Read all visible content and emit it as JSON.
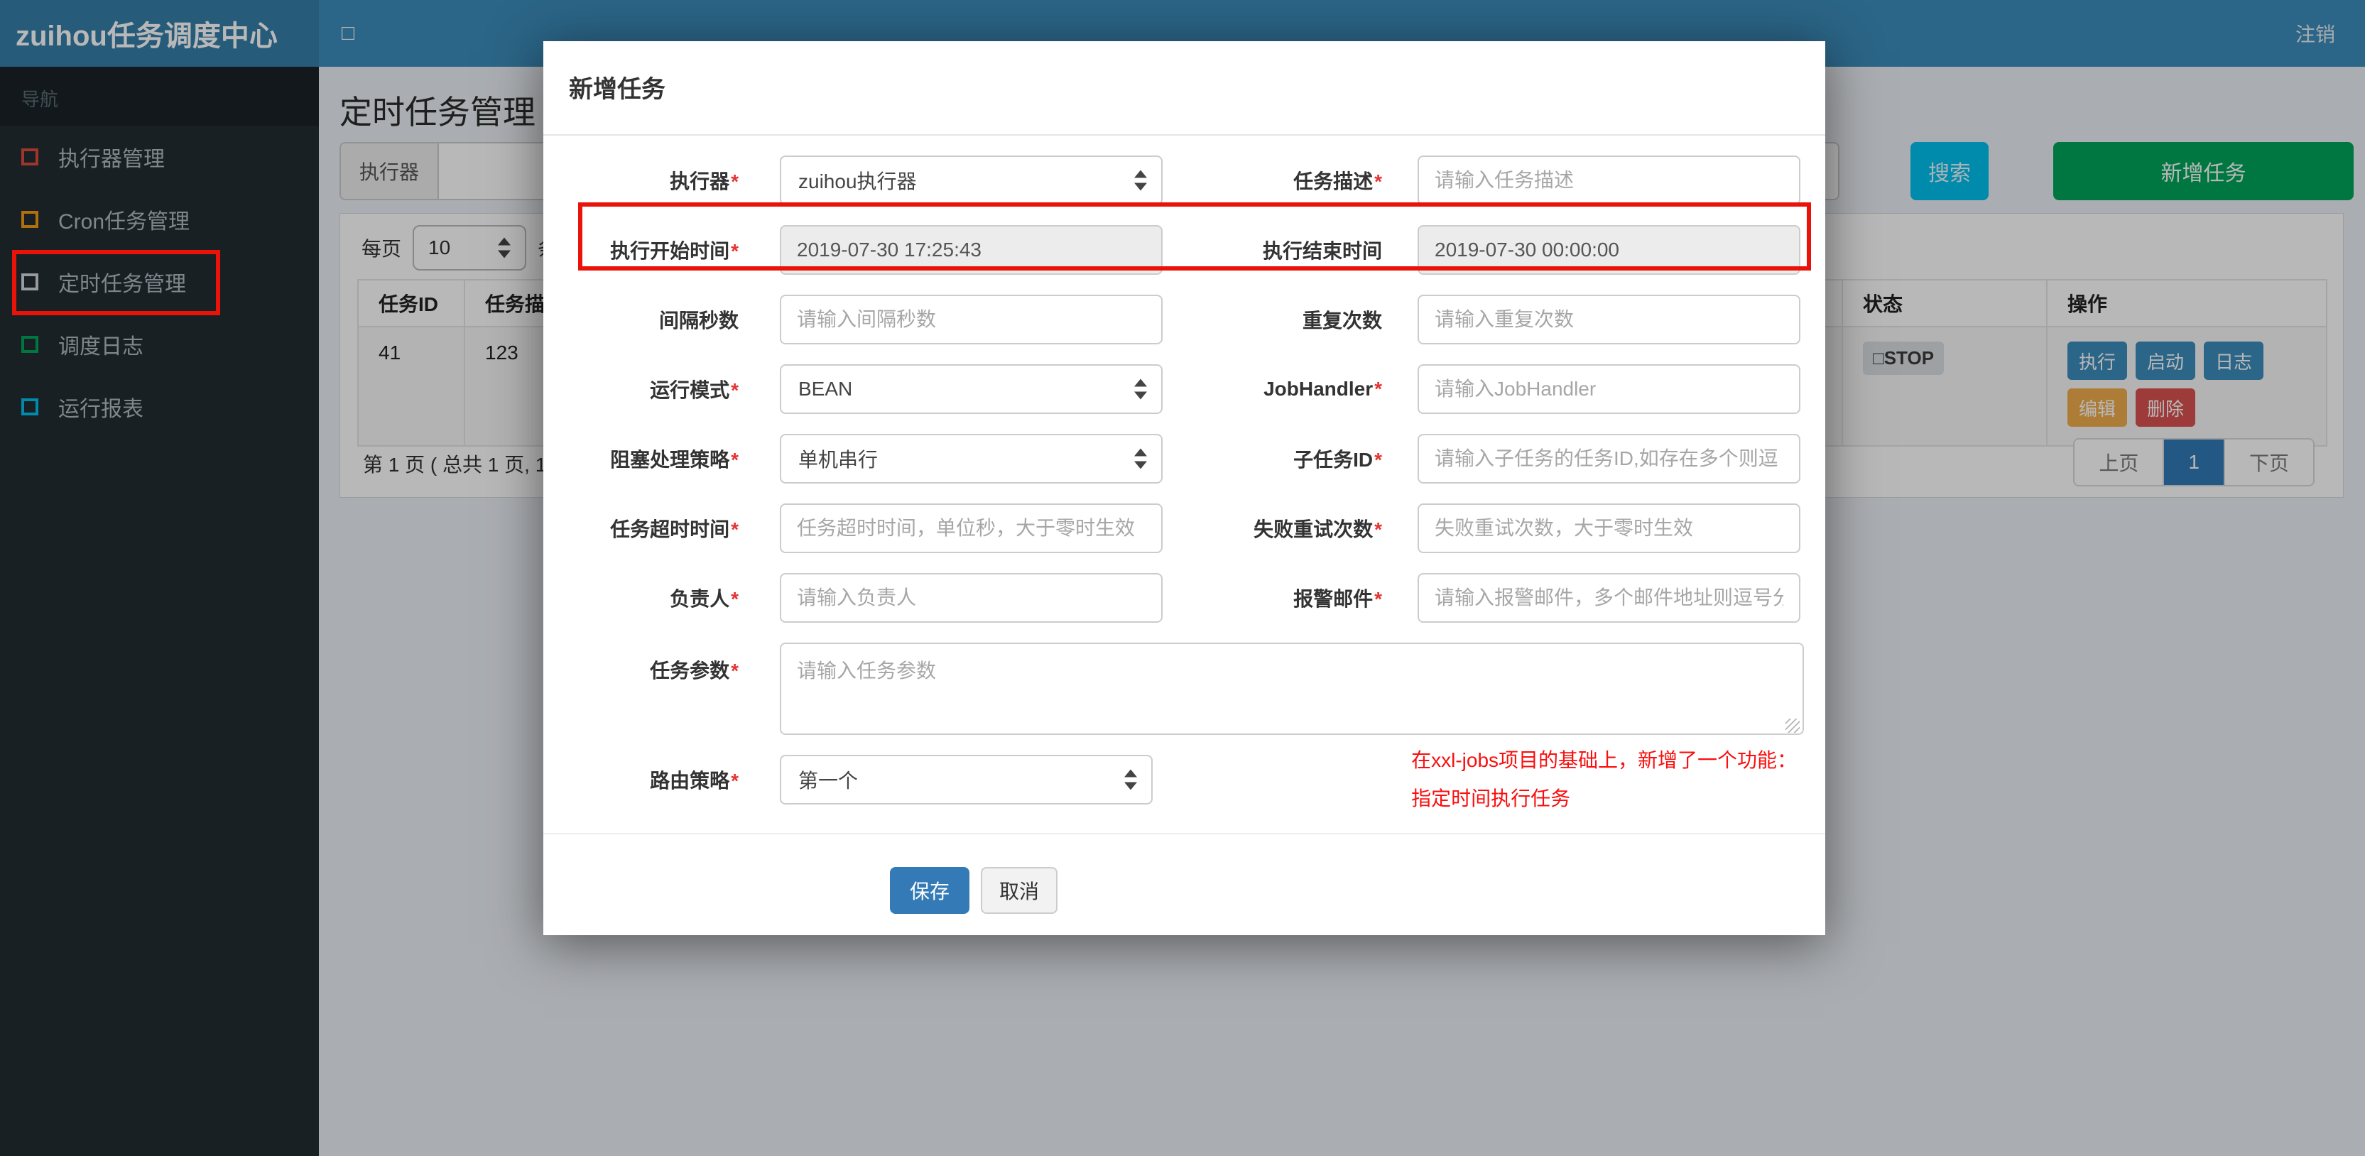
{
  "header": {
    "brand": "zuihou任务调度中心",
    "toggle_glyph": "□",
    "logout": "注销"
  },
  "sidebar": {
    "section_label": "导航",
    "items": [
      {
        "label": "执行器管理",
        "color": "#dd4b39"
      },
      {
        "label": "Cron任务管理",
        "color": "#f39c12"
      },
      {
        "label": "定时任务管理",
        "color": "#d2d6de"
      },
      {
        "label": "调度日志",
        "color": "#00a65a"
      },
      {
        "label": "运行报表",
        "color": "#00c0ef"
      }
    ]
  },
  "page": {
    "title": "定时任务管理",
    "filter": {
      "executor_addon": "执行器",
      "search_button": "搜索",
      "add_button": "新增任务"
    },
    "toolbar": {
      "per_page_prefix": "每页",
      "per_page_value": "10",
      "per_page_suffix": "条记录"
    },
    "table": {
      "columns": [
        "任务ID",
        "任务描述",
        "状态",
        "操作"
      ],
      "row": {
        "id": "41",
        "desc": "123",
        "status_icon": "□",
        "status": "STOP",
        "ops": [
          "执行",
          "启动",
          "日志",
          "编辑",
          "删除"
        ]
      }
    },
    "pagination": {
      "info": "第 1 页 ( 总共 1 页, 1",
      "prev": "上页",
      "current": "1",
      "next": "下页"
    }
  },
  "modal": {
    "title": "新增任务",
    "required_marker": "*",
    "fields": {
      "executor": {
        "label": "执行器",
        "value": "zuihou执行器"
      },
      "job_desc": {
        "label": "任务描述",
        "placeholder": "请输入任务描述"
      },
      "start_time": {
        "label": "执行开始时间",
        "value": "2019-07-30 17:25:43"
      },
      "end_time": {
        "label": "执行结束时间",
        "value": "2019-07-30 00:00:00"
      },
      "interval": {
        "label": "间隔秒数",
        "placeholder": "请输入间隔秒数"
      },
      "repeat_count": {
        "label": "重复次数",
        "placeholder": "请输入重复次数"
      },
      "glue_type": {
        "label": "运行模式",
        "value": "BEAN"
      },
      "job_handler": {
        "label": "JobHandler",
        "placeholder": "请输入JobHandler"
      },
      "block_strategy": {
        "label": "阻塞处理策略",
        "value": "单机串行"
      },
      "child_job": {
        "label": "子任务ID",
        "placeholder": "请输入子任务的任务ID,如存在多个则逗"
      },
      "timeout": {
        "label": "任务超时时间",
        "placeholder": "任务超时时间，单位秒，大于零时生效"
      },
      "retry": {
        "label": "失败重试次数",
        "placeholder": "失败重试次数，大于零时生效"
      },
      "author": {
        "label": "负责人",
        "placeholder": "请输入负责人"
      },
      "alarm_email": {
        "label": "报警邮件",
        "placeholder": "请输入报警邮件，多个邮件地址则逗号分"
      },
      "job_param": {
        "label": "任务参数",
        "placeholder": "请输入任务参数"
      },
      "route_strategy": {
        "label": "路由策略",
        "value": "第一个"
      }
    },
    "note_line1": "在xxl-jobs项目的基础上，新增了一个功能：",
    "note_line2": "指定时间执行任务",
    "save": "保存",
    "cancel": "取消"
  },
  "colors": {
    "header": "#3c8dbc",
    "logo": "#367fa9",
    "sidebar": "#222d32",
    "primary": "#337ab7",
    "info": "#00c0ef",
    "success": "#00a65a",
    "warning": "#f0ad4e",
    "danger": "#d9534f",
    "annotation": "#ea1309"
  }
}
